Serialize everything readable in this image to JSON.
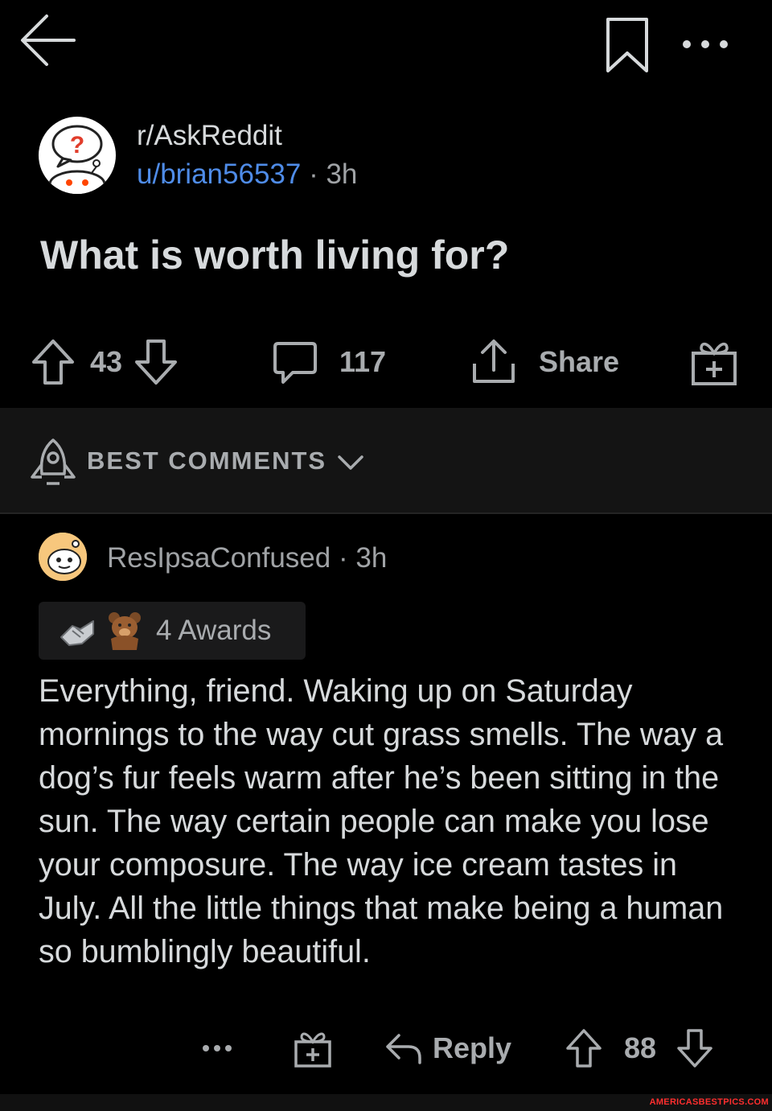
{
  "post": {
    "subreddit": "r/AskReddit",
    "author": "u/brian56537",
    "separator": "·",
    "age": "3h",
    "title": "What is worth living for?",
    "upvotes": "43",
    "comments": "117",
    "share_label": "Share"
  },
  "sort": {
    "label": "BEST COMMENTS"
  },
  "comment": {
    "author": "ResIpsaConfused",
    "separator": "·",
    "age": "3h",
    "awards_label": "4 Awards",
    "body": "Everything, friend. Waking up on Saturday mornings to the way cut grass smells. The way a dog’s fur feels warm after he’s been sitting in the sun. The way certain people can make you lose your composure. The way ice cream tastes in July. All the little things that make being a human so bumblingly beautiful.",
    "more_label": "•••",
    "reply_label": "Reply",
    "score": "88"
  },
  "watermark": "AMERICASBESTPICS.COM",
  "colors": {
    "background": "#000000",
    "text": "#d7dadc",
    "muted": "#a9acaf",
    "username_link": "#4f8ce8",
    "sort_bar": "#141414",
    "watermark": "#ff2e2e"
  },
  "icons": [
    "back-arrow-icon",
    "bookmark-icon",
    "more-icon",
    "upvote-icon",
    "downvote-icon",
    "comment-bubble-icon",
    "share-icon",
    "gift-icon",
    "rocket-icon",
    "chevron-down-icon",
    "reply-icon"
  ]
}
